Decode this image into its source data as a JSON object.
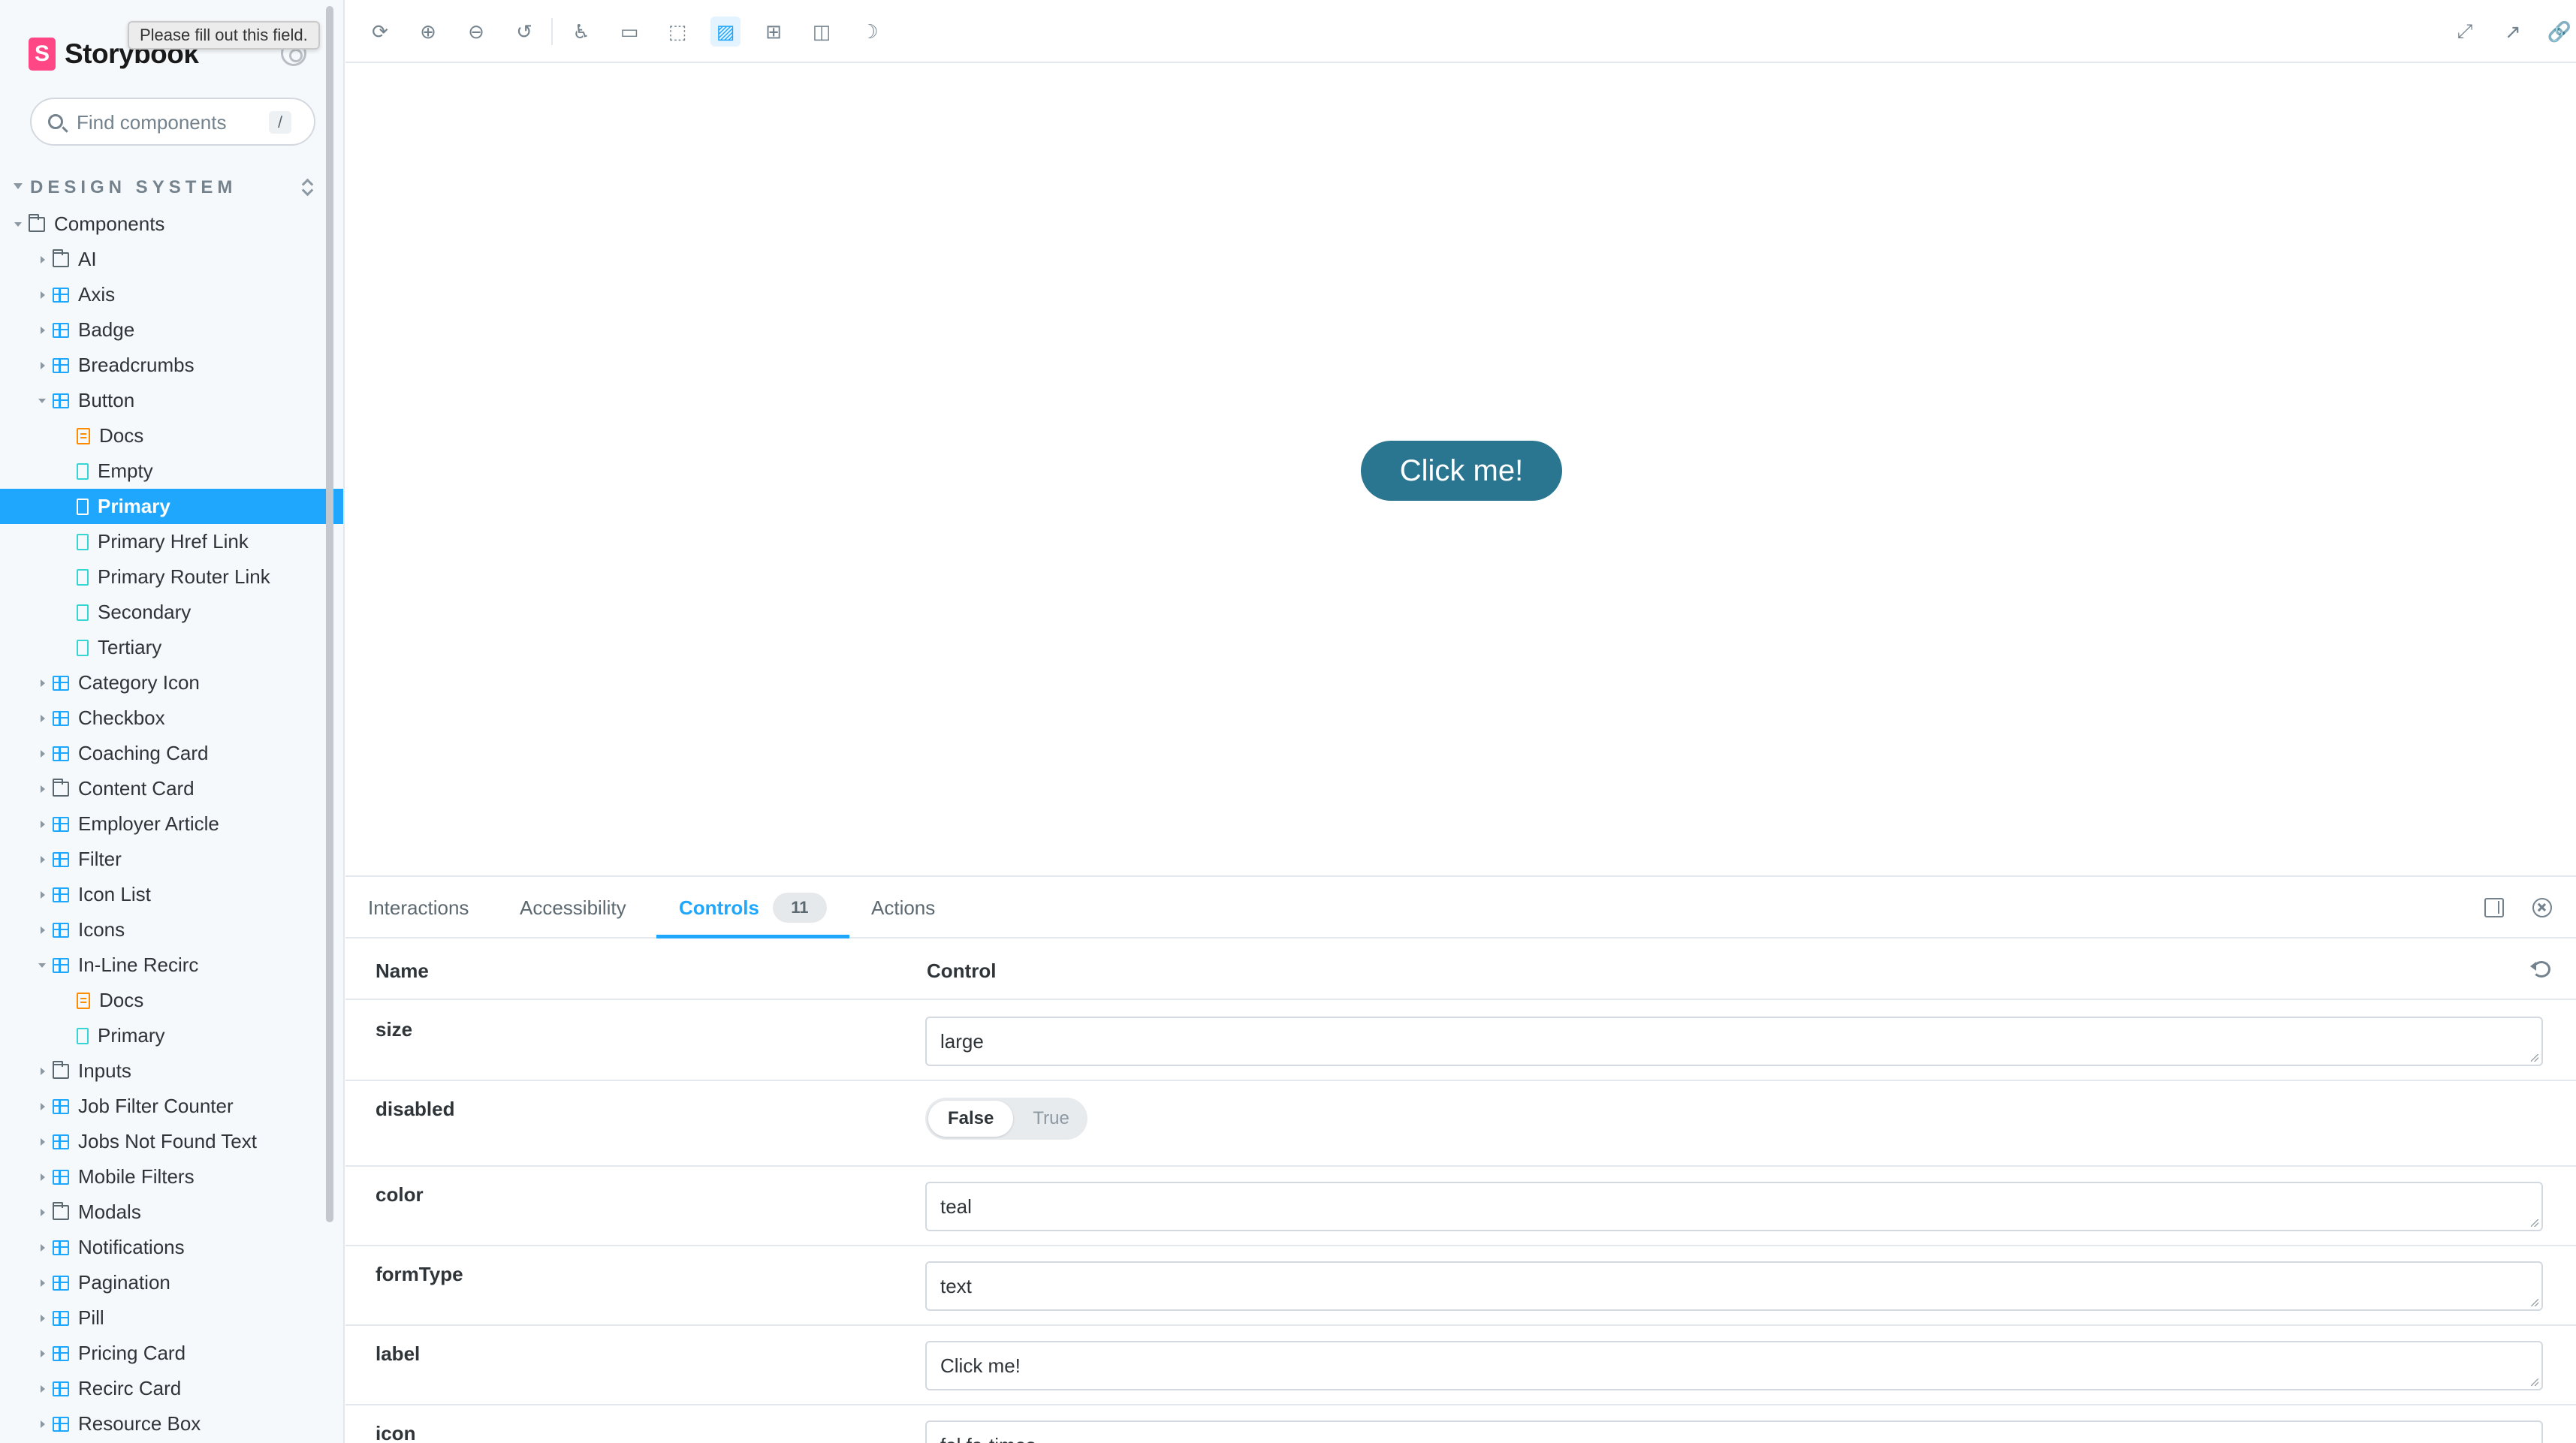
{
  "sidebar": {
    "brand": "Storybook",
    "tooltip": "Please fill out this field.",
    "search_placeholder": "Find components",
    "search_shortcut": "/",
    "section_label": "DESIGN SYSTEM",
    "tree": [
      {
        "label": "Components",
        "type": "folder",
        "level": 0,
        "expanded": true
      },
      {
        "label": "AI",
        "type": "folder",
        "level": 1,
        "expanded": false
      },
      {
        "label": "Axis",
        "type": "component",
        "level": 1,
        "expanded": false
      },
      {
        "label": "Badge",
        "type": "component",
        "level": 1,
        "expanded": false
      },
      {
        "label": "Breadcrumbs",
        "type": "component",
        "level": 1,
        "expanded": false
      },
      {
        "label": "Button",
        "type": "component",
        "level": 1,
        "expanded": true
      },
      {
        "label": "Docs",
        "type": "doc",
        "level": 2
      },
      {
        "label": "Empty",
        "type": "story",
        "level": 2
      },
      {
        "label": "Primary",
        "type": "story",
        "level": 2,
        "selected": true
      },
      {
        "label": "Primary Href Link",
        "type": "story",
        "level": 2
      },
      {
        "label": "Primary Router Link",
        "type": "story",
        "level": 2
      },
      {
        "label": "Secondary",
        "type": "story",
        "level": 2
      },
      {
        "label": "Tertiary",
        "type": "story",
        "level": 2
      },
      {
        "label": "Category Icon",
        "type": "component",
        "level": 1,
        "expanded": false
      },
      {
        "label": "Checkbox",
        "type": "component",
        "level": 1,
        "expanded": false
      },
      {
        "label": "Coaching Card",
        "type": "component",
        "level": 1,
        "expanded": false
      },
      {
        "label": "Content Card",
        "type": "folder",
        "level": 1,
        "expanded": false
      },
      {
        "label": "Employer Article",
        "type": "component",
        "level": 1,
        "expanded": false
      },
      {
        "label": "Filter",
        "type": "component",
        "level": 1,
        "expanded": false
      },
      {
        "label": "Icon List",
        "type": "component",
        "level": 1,
        "expanded": false
      },
      {
        "label": "Icons",
        "type": "component",
        "level": 1,
        "expanded": false
      },
      {
        "label": "In-Line Recirc",
        "type": "component",
        "level": 1,
        "expanded": true
      },
      {
        "label": "Docs",
        "type": "doc",
        "level": 2
      },
      {
        "label": "Primary",
        "type": "story",
        "level": 2
      },
      {
        "label": "Inputs",
        "type": "folder",
        "level": 1,
        "expanded": false
      },
      {
        "label": "Job Filter Counter",
        "type": "component",
        "level": 1,
        "expanded": false
      },
      {
        "label": "Jobs Not Found Text",
        "type": "component",
        "level": 1,
        "expanded": false
      },
      {
        "label": "Mobile Filters",
        "type": "component",
        "level": 1,
        "expanded": false
      },
      {
        "label": "Modals",
        "type": "folder",
        "level": 1,
        "expanded": false
      },
      {
        "label": "Notifications",
        "type": "component",
        "level": 1,
        "expanded": false
      },
      {
        "label": "Pagination",
        "type": "component",
        "level": 1,
        "expanded": false
      },
      {
        "label": "Pill",
        "type": "component",
        "level": 1,
        "expanded": false
      },
      {
        "label": "Pricing Card",
        "type": "component",
        "level": 1,
        "expanded": false
      },
      {
        "label": "Recirc Card",
        "type": "component",
        "level": 1,
        "expanded": false
      },
      {
        "label": "Resource Box",
        "type": "component",
        "level": 1,
        "expanded": false
      }
    ]
  },
  "toolbar": {
    "left_icons": [
      "reload-icon",
      "zoom-in-icon",
      "zoom-out-icon",
      "zoom-reset-icon",
      "accessibility-icon",
      "viewport-icon",
      "outline-icon",
      "background-icon",
      "grid-icon",
      "measure-icon",
      "theme-icon"
    ],
    "active_icon": "background-icon",
    "right_icons": [
      "fullscreen-icon",
      "open-new-tab-icon",
      "copy-link-icon"
    ]
  },
  "preview": {
    "button_label": "Click me!",
    "button_color": "#2a7590"
  },
  "addons": {
    "tabs": [
      {
        "label": "Interactions"
      },
      {
        "label": "Accessibility"
      },
      {
        "label": "Controls",
        "count": "11",
        "active": true
      },
      {
        "label": "Actions"
      }
    ],
    "header": {
      "name": "Name",
      "control": "Control"
    },
    "controls": [
      {
        "name": "size",
        "kind": "text",
        "value": "large"
      },
      {
        "name": "disabled",
        "kind": "boolean",
        "false_label": "False",
        "true_label": "True",
        "value": false
      },
      {
        "name": "color",
        "kind": "text",
        "value": "teal"
      },
      {
        "name": "formType",
        "kind": "text",
        "value": "text"
      },
      {
        "name": "label",
        "kind": "text",
        "value": "Click me!"
      },
      {
        "name": "icon",
        "kind": "text",
        "value": "fal fa-times"
      }
    ]
  },
  "colors": {
    "accent": "#1ea7fd",
    "brand": "#ff4785",
    "button_teal": "#2a7590"
  }
}
